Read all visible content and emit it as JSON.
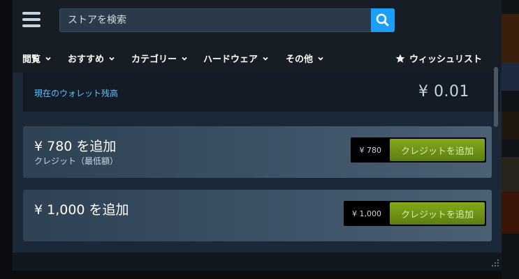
{
  "header": {
    "menu_icon": "hamburger-menu-icon",
    "search_placeholder": "ストアを検索",
    "search_icon": "search-icon"
  },
  "nav": {
    "items": [
      {
        "label": "閲覧"
      },
      {
        "label": "おすすめ"
      },
      {
        "label": "カテゴリー"
      },
      {
        "label": "ハードウェア"
      },
      {
        "label": "その他"
      }
    ],
    "wishlist_label": "ウィッシュリスト"
  },
  "wallet": {
    "balance_label": "現在のウォレット残高",
    "balance_value": "¥ 0.01"
  },
  "offers": [
    {
      "title": "¥ 780 を追加",
      "subtitle": "クレジット（最低額）",
      "price": "¥ 780",
      "button": "クレジットを追加"
    },
    {
      "title": "¥ 1,000 を追加",
      "subtitle": "",
      "price": "¥ 1,000",
      "button": "クレジットを追加"
    }
  ],
  "colors": {
    "accent_blue": "#1a9fff",
    "button_green": "#5c7e10",
    "label_blue": "#66c0f4"
  }
}
